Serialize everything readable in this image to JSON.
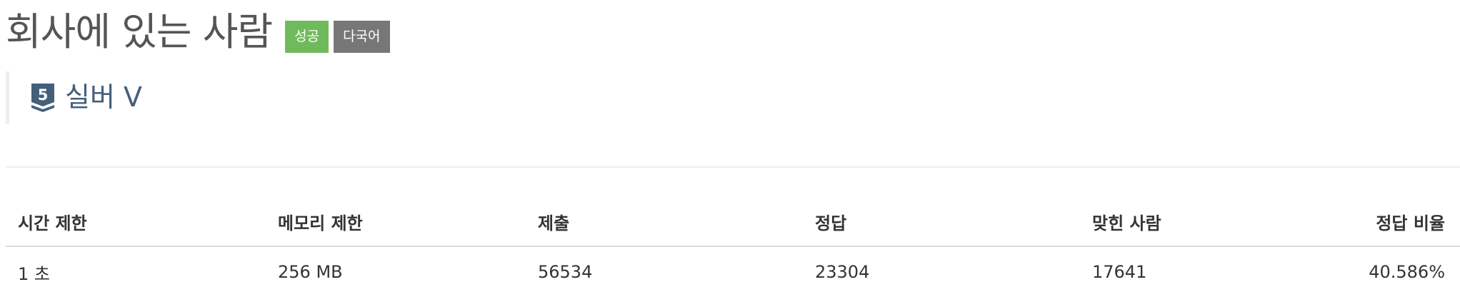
{
  "problem": {
    "title": "회사에 있는 사람",
    "labels": {
      "status": "성공",
      "language": "다국어"
    },
    "tier": {
      "icon": "silver-tier-badge-icon",
      "icon_number": "5",
      "name": "실버 V",
      "color": "#435f7a"
    }
  },
  "colors": {
    "success_label": "#6fbb5b",
    "language_label": "#777777"
  },
  "info_table": {
    "headers": {
      "time_limit": "시간 제한",
      "memory_limit": "메모리 제한",
      "submissions": "제출",
      "accepted": "정답",
      "solvers": "맞힌 사람",
      "ratio": "정답 비율"
    },
    "values": {
      "time_limit": "1 초",
      "memory_limit": "256 MB",
      "submissions": "56534",
      "accepted": "23304",
      "solvers": "17641",
      "ratio": "40.586%"
    }
  }
}
